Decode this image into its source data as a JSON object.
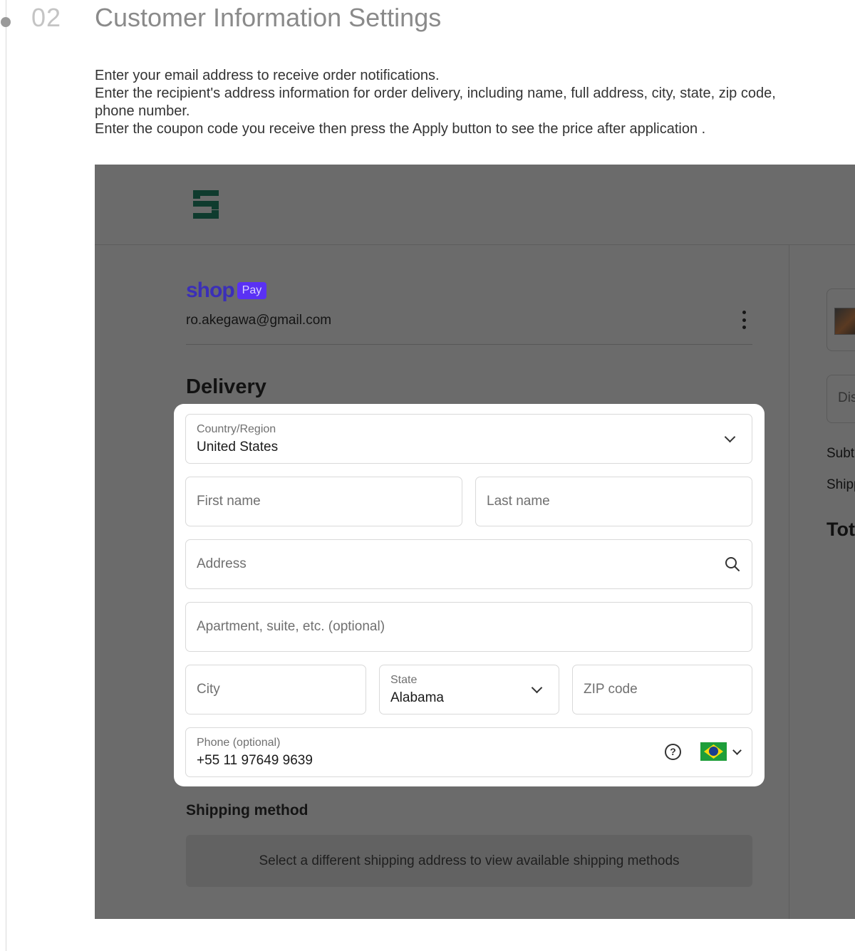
{
  "step": {
    "number": "02",
    "title": "Customer Information Settings"
  },
  "instructions": [
    "Enter your email address to receive order notifications.",
    "Enter the recipient's address information for order delivery, including name, full address, city, state, zip code, phone number.",
    "Enter the coupon code you receive then press the Apply button to see the price after application ."
  ],
  "checkout": {
    "shoppay": {
      "shop": "shop",
      "pay": "Pay"
    },
    "account_email": "ro.akegawa@gmail.com",
    "delivery_heading": "Delivery",
    "form": {
      "country": {
        "label": "Country/Region",
        "value": "United States"
      },
      "first_name": {
        "placeholder": "First name"
      },
      "last_name": {
        "placeholder": "Last name"
      },
      "address": {
        "placeholder": "Address"
      },
      "apartment": {
        "placeholder": "Apartment, suite, etc. (optional)"
      },
      "city": {
        "placeholder": "City"
      },
      "state": {
        "label": "State",
        "value": "Alabama"
      },
      "zip": {
        "placeholder": "ZIP code"
      },
      "phone": {
        "label": "Phone (optional)",
        "value": "+55 11 97649 9639",
        "help_glyph": "?"
      }
    },
    "shipping": {
      "heading": "Shipping method",
      "message": "Select a different shipping address to view available shipping methods"
    },
    "summary": {
      "discount_placeholder": "Dis",
      "subtotal": "Subt",
      "shipping": "Shipp",
      "total": "Tota"
    }
  },
  "colors": {
    "overlay": "#6b6b6b",
    "shop_pay": "#5a31f4",
    "logo": "#0f3b2e"
  },
  "icons": [
    "timeline-dot",
    "store-logo-icon",
    "kebab-menu-icon",
    "chevron-down-icon",
    "search-icon",
    "help-circle-icon",
    "brazil-flag-icon"
  ]
}
